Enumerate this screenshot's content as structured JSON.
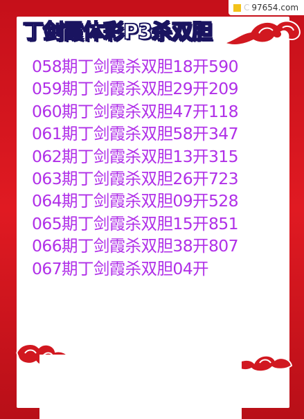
{
  "title": "丁剑霞体彩P3杀双胆",
  "watermark": {
    "letter": "C",
    "site": "97654.com"
  },
  "colors": {
    "frame": "#d8141c",
    "text": "#b030e8",
    "title_outline": "#1a1460"
  },
  "rows": [
    "058期丁剑霞杀双胆18开590",
    "059期丁剑霞杀双胆29开209",
    "060期丁剑霞杀双胆47开118",
    "061期丁剑霞杀双胆58开347",
    "062期丁剑霞杀双胆13开315",
    "063期丁剑霞杀双胆26开723",
    "064期丁剑霞杀双胆09开528",
    "065期丁剑霞杀双胆15开851",
    "066期丁剑霞杀双胆38开807",
    "067期丁剑霞杀双胆04开"
  ]
}
